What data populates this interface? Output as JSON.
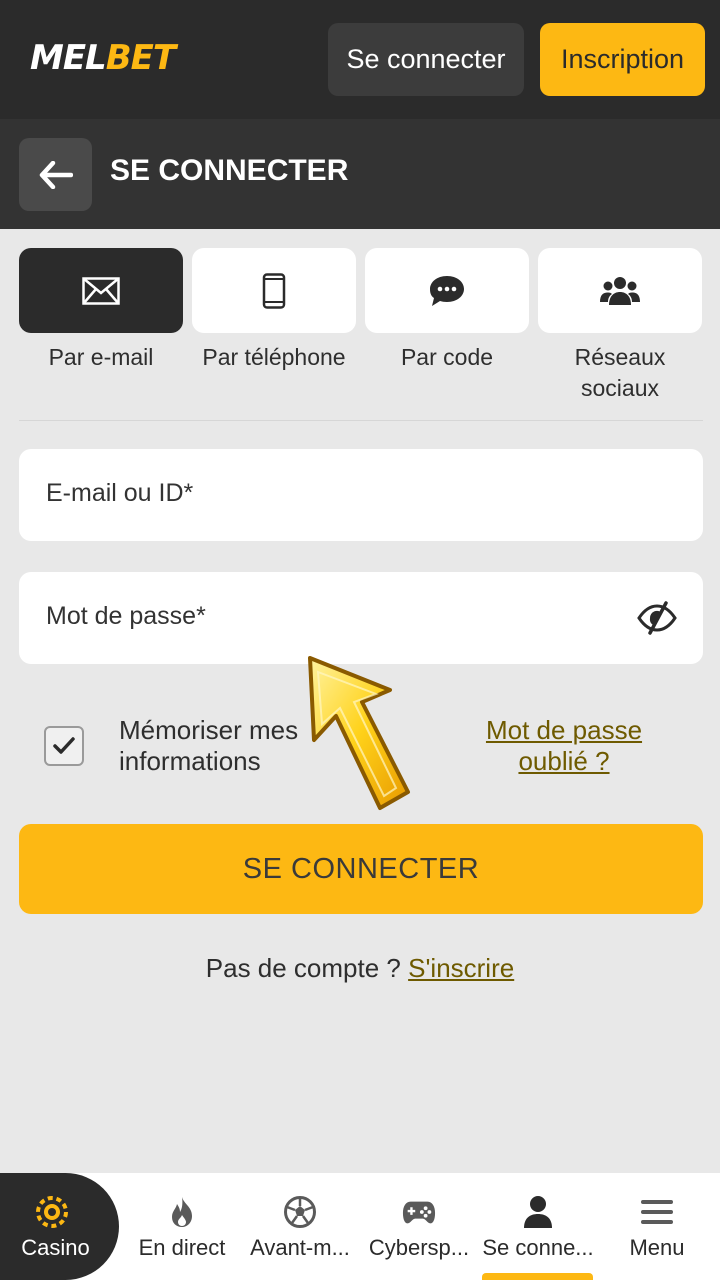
{
  "header": {
    "logo_part1": "MEL",
    "logo_part2": "BET",
    "login_label": "Se connecter",
    "register_label": "Inscription"
  },
  "subheader": {
    "title": "SE CONNECTER"
  },
  "methods": [
    {
      "label": "Par e-mail",
      "icon": "envelope-icon",
      "active": true
    },
    {
      "label": "Par téléphone",
      "icon": "phone-icon",
      "active": false
    },
    {
      "label": "Par code",
      "icon": "chat-bubble-icon",
      "active": false
    },
    {
      "label": "Réseaux sociaux",
      "icon": "users-icon",
      "active": false
    }
  ],
  "form": {
    "email_placeholder": "E-mail ou ID*",
    "password_placeholder": "Mot de passe*",
    "remember_label": "Mémoriser mes informations",
    "remember_checked": true,
    "forgot_label": "Mot de passe oublié ?",
    "submit_label": "SE CONNECTER",
    "no_account_text": "Pas de compte ? ",
    "signup_link": "S'inscrire"
  },
  "bottom_nav": [
    {
      "label": "Casino",
      "icon": "casino-chip-icon"
    },
    {
      "label": "En direct",
      "icon": "flame-icon"
    },
    {
      "label": "Avant-m...",
      "icon": "soccer-ball-icon"
    },
    {
      "label": "Cybersp...",
      "icon": "gamepad-icon"
    },
    {
      "label": "Se conne...",
      "icon": "user-icon",
      "active": true
    },
    {
      "label": "Menu",
      "icon": "hamburger-menu-icon"
    }
  ],
  "colors": {
    "accent": "#fdb813",
    "dark": "#2b2b2b",
    "background": "#e8e8e8",
    "link": "#6e5a00"
  }
}
